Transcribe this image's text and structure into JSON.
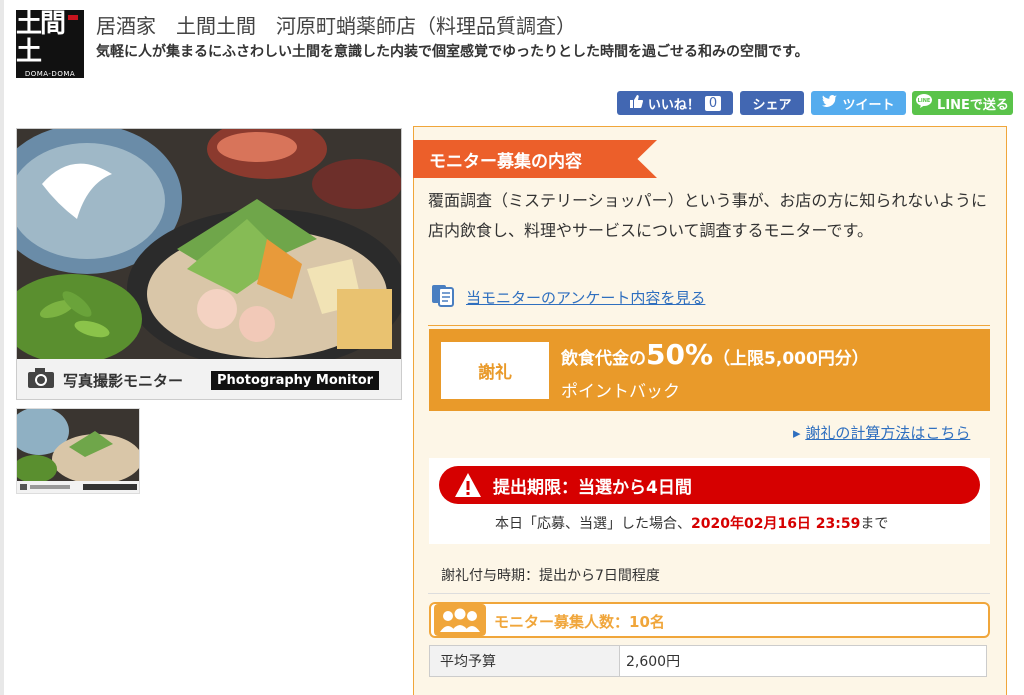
{
  "header": {
    "logo_text": "土間土",
    "logo_sub": "DOMA-DOMA",
    "title": "居酒家　土間土間　河原町蛸薬師店（料理品質調査）",
    "subtitle": "気軽に人が集まるにふさわしい土間を意識した内装で個室感覚でゆったりとした時間を過ごせる和みの空間です。"
  },
  "social": {
    "like_label": "いいね！",
    "like_count": "0",
    "share_label": "シェア",
    "tweet_label": "ツイート",
    "line_label": "LINEで送る"
  },
  "photo": {
    "caption_jp": "写真撮影モニター",
    "caption_en": "Photography Monitor"
  },
  "monitor": {
    "heading": "モニター募集の内容",
    "description": "覆面調査（ミステリーショッパー）という事が、お店の方に知られないように店内飲食し、料理やサービスについて調査するモニターです。",
    "survey_link": "当モニターのアンケート内容を見る"
  },
  "reward": {
    "label": "謝礼",
    "line1_prefix": "飲食代金の",
    "percent": "50%",
    "line1_suffix": "（上限5,000円分）",
    "line2": "ポイントバック",
    "calc_link": "謝礼の計算方法はこちら"
  },
  "deadline": {
    "label": "提出期限：当選から4日間",
    "note_prefix": "本日「応募、当選」した場合、",
    "date": "2020年02月16日 23:59",
    "note_suffix": "まで"
  },
  "grant_timing": "謝礼付与時期：提出から7日間程度",
  "recruit": {
    "label": "モニター募集人数：10名"
  },
  "budget": {
    "key": "平均予算",
    "value": "2,600円"
  },
  "colors": {
    "accent_orange": "#e99a2a",
    "ribbon": "#ec5f2a",
    "deadline_red": "#d60000",
    "link_blue": "#2f6fbf"
  }
}
